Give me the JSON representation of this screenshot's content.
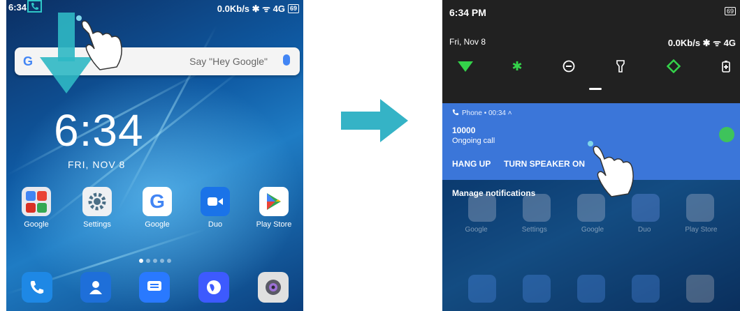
{
  "left_screen": {
    "status_time": "6:34",
    "status_right": "0.0Kb/s ✱ ᯤ 4G",
    "battery": "69",
    "search_placeholder": "Say \"Hey Google\"",
    "clock": "6:34",
    "date": "FRI, NOV 8",
    "apps": [
      {
        "label": "Google",
        "icon": "google-folder-icon"
      },
      {
        "label": "Settings",
        "icon": "settings-gear-icon"
      },
      {
        "label": "Google",
        "icon": "google-g-icon"
      },
      {
        "label": "Duo",
        "icon": "duo-camera-icon"
      },
      {
        "label": "Play Store",
        "icon": "play-store-icon"
      }
    ],
    "dock": [
      "phone-icon",
      "contacts-icon",
      "messages-icon",
      "browser-globe-icon",
      "camera-icon"
    ]
  },
  "right_screen": {
    "status_time": "6:34 PM",
    "battery": "69",
    "date": "Fri, Nov 8",
    "status_right": "0.0Kb/s ✱ ᯤ 4G",
    "quick_settings": [
      "wifi-icon",
      "bluetooth-icon",
      "do-not-disturb-icon",
      "flashlight-icon",
      "auto-rotate-icon",
      "battery-saver-icon"
    ],
    "notification": {
      "header": "Phone • 00:34 ˄",
      "number": "10000",
      "status": "Ongoing call",
      "action_hang_up": "HANG UP",
      "action_speaker": "TURN SPEAKER ON"
    },
    "manage": "Manage notifications",
    "apps_dimmed": [
      "Google",
      "Settings",
      "Google",
      "Duo",
      "Play Store"
    ]
  },
  "colors": {
    "accent_teal": "#2fc7c7",
    "notif_blue": "#3b76d9",
    "qs_green": "#34d34a"
  }
}
